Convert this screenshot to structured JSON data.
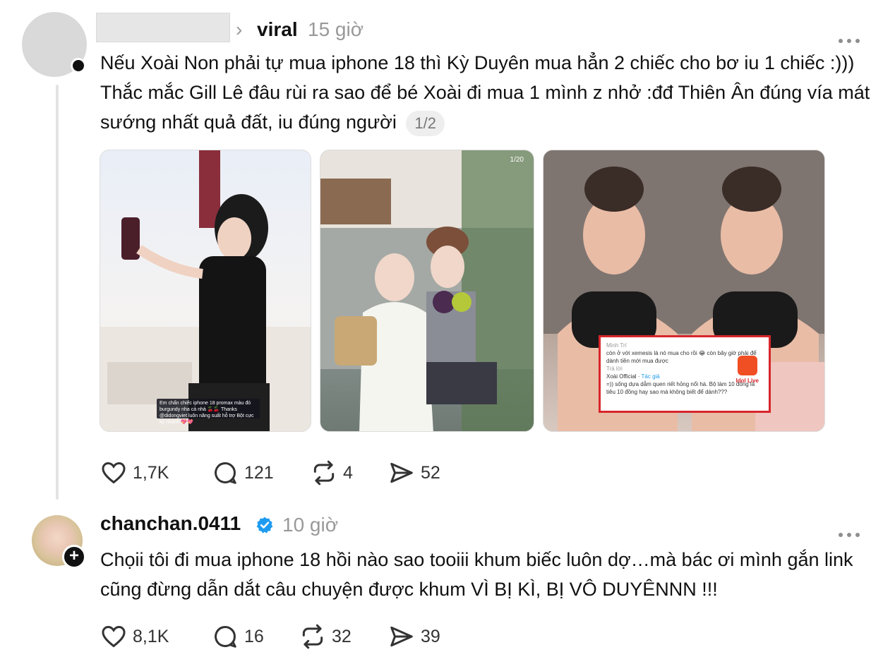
{
  "post1": {
    "username": "",
    "topic": "viral",
    "time": "15 giờ",
    "text": "Nếu Xoài Non phải tự mua iphone 18 thì Kỳ Duyên mua hẳn 2 chiếc cho bơ iu 1 chiếc :))) Thắc mắc Gill Lê đâu rùi ra sao để bé Xoài đi mua 1 mình z nhở :đđ Thiên Ân đúng vía mát sướng nhất quả đất, iu đúng người",
    "page_indicator": "1/2",
    "images": [
      {
        "caption": "Em chấn chiếc iphone 18 promax màu đỏ burgundy nha cả nhà 🍒🍒 Thanks @didongviet luôn năng suất hỗ trợ Bột cực kỳ nhanh 💖💖"
      },
      {
        "counter": "1/20"
      },
      {
        "comment_user": "Minh Trí",
        "comment_text": "còn ở với xemesis là nó mua cho rồi 😂 còn bây giờ phải để dành tiền mới mua được",
        "reply_label": "Trả lời",
        "reply_user": "Xoài Official",
        "reply_badge": "Tác giả",
        "reply_text": "=)) sống dựa dẫm quen riết hỏng nổi hà. Bộ làm 10 đồng là tiêu 10 đồng hay sao mà không biết để dành???",
        "logo_text": "Idol Live"
      }
    ],
    "stats": {
      "likes": "1,7K",
      "comments": "121",
      "reposts": "4",
      "shares": "52"
    }
  },
  "post2": {
    "username": "chanchan.0411",
    "time": "10 giờ",
    "text": "Chọii tôi đi mua iphone 18 hồi nào sao tooiii khum biếc luôn dợ…mà bác ơi mình gắn link cũng đừng dẫn dắt câu chuyện được khum VÌ BỊ KÌ, BỊ VÔ DUYÊNNN !!!",
    "stats": {
      "likes": "8,1K",
      "comments": "16",
      "reposts": "32",
      "shares": "39"
    }
  },
  "colors": {
    "verified": "#1d9bf0",
    "muted": "#999999",
    "accent_red": "#d7262b"
  }
}
